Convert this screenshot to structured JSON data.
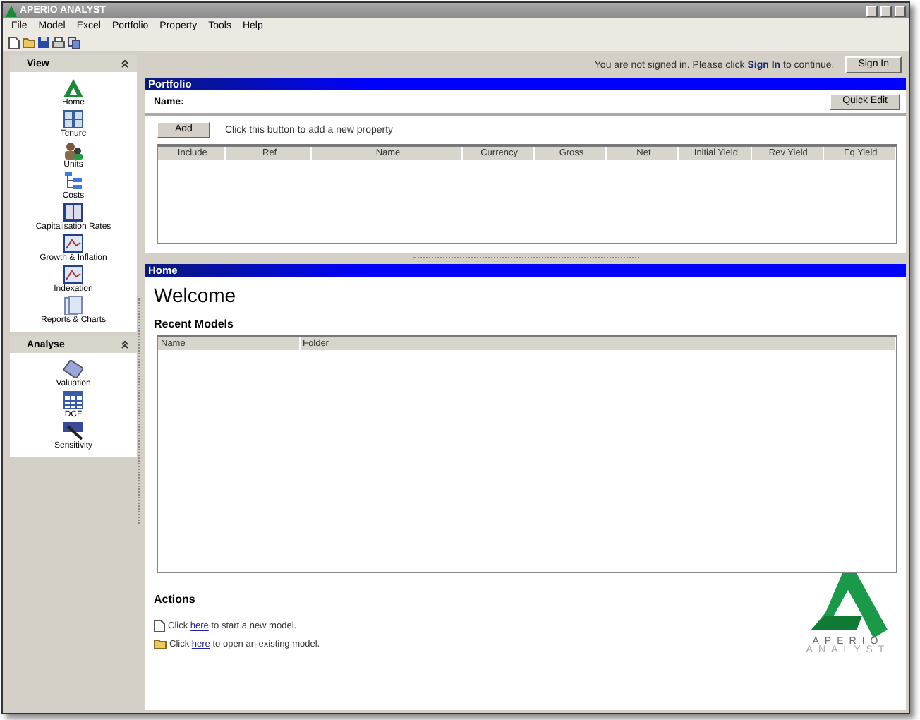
{
  "window": {
    "title": "APERIO ANALYST"
  },
  "menu": [
    "File",
    "Model",
    "Excel",
    "Portfolio",
    "Property",
    "Tools",
    "Help"
  ],
  "toolbar": [
    {
      "kind": "new"
    },
    {
      "kind": "open"
    },
    {
      "kind": "save"
    },
    {
      "kind": "print"
    },
    {
      "kind": "copy"
    }
  ],
  "sidebar": [
    {
      "title": "View",
      "expanded": true,
      "items": [
        {
          "label": "Home",
          "kind": "home"
        },
        {
          "label": "Tenure",
          "kind": "grid"
        },
        {
          "label": "Units",
          "kind": "people"
        },
        {
          "label": "Costs",
          "kind": "tree"
        },
        {
          "label": "Capitalisation Rates",
          "kind": "book"
        },
        {
          "label": "Growth & Inflation",
          "kind": "chart"
        },
        {
          "label": "Indexation",
          "kind": "chart"
        },
        {
          "label": "Reports & Charts",
          "kind": "report"
        }
      ]
    },
    {
      "title": "Analyse",
      "expanded": true,
      "items": [
        {
          "label": "Valuation",
          "kind": "calc"
        },
        {
          "label": "DCF",
          "kind": "table"
        },
        {
          "label": "Sensitivity",
          "kind": "wand"
        }
      ]
    }
  ],
  "signin": {
    "message": "You are not signed in.  Please click **Sign In** to continue.",
    "button": "Sign In"
  },
  "portfolio": {
    "title": "Portfolio",
    "name_label": "Name:",
    "quick_edit": "Quick Edit",
    "add": "Add",
    "add_hint": "Click this button to add a new property",
    "columns": [
      "Include",
      "Ref",
      "Name",
      "Currency",
      "Gross",
      "Net",
      "Initial Yield",
      "Rev Yield",
      "Eq Yield"
    ]
  },
  "home": {
    "title": "Home",
    "welcome": "Welcome",
    "recent_title": "Recent Models",
    "recent_columns": [
      "Name",
      "Folder"
    ],
    "actions_title": "Actions",
    "actions": [
      {
        "kind": "new",
        "before": "Click",
        "link": "here",
        "after": "to start a new model."
      },
      {
        "kind": "open",
        "before": "Click",
        "link": "here",
        "after": "to open an existing model."
      }
    ],
    "logo": {
      "top": "APERIO",
      "bottom": "ANALYST"
    }
  }
}
